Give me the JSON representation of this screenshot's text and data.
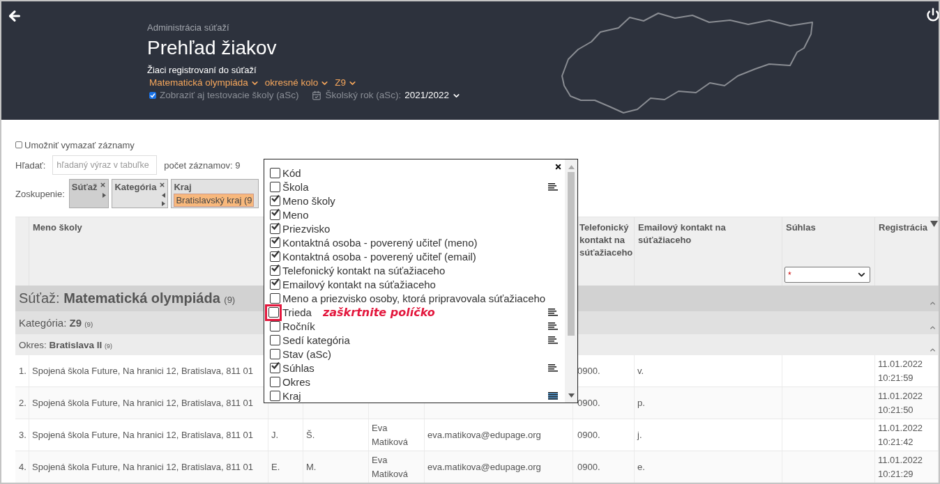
{
  "header": {
    "breadcrumb": "Administrácia súťaží",
    "title": "Prehľad žiakov",
    "subtitle": "Žiaci registrovaní do súťaží",
    "filters": [
      "Matematická olympiáda",
      "okresné kolo",
      "Z9"
    ],
    "test_schools": {
      "label": "Zobraziť aj testovacie školy (aSc)",
      "checked": true
    },
    "school_year": {
      "label": "Školský rok (aSc):",
      "value": "2021/2022"
    }
  },
  "allow_delete": {
    "label": "Umožniť vymazať záznamy",
    "checked": false
  },
  "search": {
    "label": "Hľadať:",
    "placeholder": "hľadaný výraz v tabuľke"
  },
  "record_count": "počet záznamov: 9",
  "grouping": {
    "label": "Zoskupenie:",
    "chips": [
      {
        "label": "Súťaž",
        "selected": true,
        "removable": true,
        "move_left": false,
        "move_right": true
      },
      {
        "label": "Kategória",
        "selected": false,
        "removable": true,
        "move_left": true,
        "move_right": true
      },
      {
        "label": "Kraj",
        "selected": false,
        "value": "Bratislavský kraj (9"
      }
    ]
  },
  "table": {
    "columns": [
      {
        "label": "Meno školy"
      },
      {
        "label": "Telefonický kontakt na súťažiaceho"
      },
      {
        "label": "Emailový kontakt na súťažiaceho"
      },
      {
        "label": "Súhlas",
        "filter": "*"
      },
      {
        "label": "Registrácia",
        "sorted": true
      }
    ],
    "groups": [
      {
        "kind": "competition",
        "label": "Súťaž:",
        "value": "Matematická olympiáda",
        "count": "(9)",
        "expanded": true
      },
      {
        "kind": "category",
        "label": "Kategória:",
        "value": "Z9",
        "count": "(9)",
        "expanded": true
      },
      {
        "kind": "district",
        "label": "Okres:",
        "value": "Bratislava II",
        "count": "(9)",
        "expanded": true
      }
    ],
    "rows": [
      {
        "number": "1.",
        "school": "Spojená škola Future, Na hranici 12, Bratislava, 811 01",
        "phone": "0900.",
        "email": "v.",
        "registered": "11.01.2022 10:21:59"
      },
      {
        "number": "2.",
        "school": "Spojená škola Future, Na hranici 12, Bratislava, 811 01",
        "phone": "0900.",
        "email": "p.",
        "registered": "11.01.2022 10:21:50"
      },
      {
        "number": "3.",
        "school": "Spojená škola Future, Na hranici 12, Bratislava, 811 01",
        "first_name": "J.",
        "last_name": "Š.",
        "teacher": "Eva Matiková",
        "teacher_email": "eva.matikova@edupage.org",
        "phone": "0900.",
        "email": "j.",
        "registered": "11.01.2022 10:21:42"
      },
      {
        "number": "4.",
        "school": "Spojená škola Future, Na hranici 12, Bratislava, 811 01",
        "first_name": "E.",
        "last_name": "M.",
        "teacher": "Eva Matiková",
        "teacher_email": "eva.matikova@edupage.org",
        "phone": "0900.",
        "email": "e.",
        "registered": "11.01.2022 10:21:29"
      }
    ]
  },
  "column_picker": {
    "items": [
      {
        "label": "Kód",
        "checked": false,
        "highlighted": false,
        "sortable": false
      },
      {
        "label": "Škola",
        "checked": false,
        "highlighted": false,
        "sortable": true,
        "sort_active": false
      },
      {
        "label": "Meno školy",
        "checked": true,
        "highlighted": false,
        "sortable": false
      },
      {
        "label": "Meno",
        "checked": true,
        "highlighted": false,
        "sortable": false
      },
      {
        "label": "Priezvisko",
        "checked": true,
        "highlighted": false,
        "sortable": false
      },
      {
        "label": "Kontaktná osoba - poverený učiteľ (meno)",
        "checked": true,
        "highlighted": false,
        "sortable": false
      },
      {
        "label": "Kontaktná osoba - poverený učiteľ (email)",
        "checked": true,
        "highlighted": false,
        "sortable": false
      },
      {
        "label": "Telefonický kontakt na súťažiaceho",
        "checked": true,
        "highlighted": false,
        "sortable": false
      },
      {
        "label": "Emailový kontakt na súťažiaceho",
        "checked": true,
        "highlighted": false,
        "sortable": false
      },
      {
        "label": "Meno a priezvisko osoby, ktorá pripravovala súťažiaceho",
        "checked": false,
        "highlighted": false,
        "sortable": false
      },
      {
        "label": "Trieda",
        "checked": false,
        "highlighted": true,
        "note": "zaškrtnite políčko",
        "sortable": true,
        "sort_active": false
      },
      {
        "label": "Ročník",
        "checked": false,
        "highlighted": false,
        "sortable": true,
        "sort_active": false
      },
      {
        "label": "Sedí kategória",
        "checked": false,
        "highlighted": false,
        "sortable": true,
        "sort_active": false
      },
      {
        "label": "Stav (aSc)",
        "checked": false,
        "highlighted": false,
        "sortable": false
      },
      {
        "label": "Súhlas",
        "checked": true,
        "highlighted": false,
        "sortable": true,
        "sort_active": false
      },
      {
        "label": "Okres",
        "checked": false,
        "highlighted": false,
        "sortable": false
      },
      {
        "label": "Kraj",
        "checked": false,
        "highlighted": false,
        "sortable": true,
        "sort_active": true
      }
    ]
  }
}
